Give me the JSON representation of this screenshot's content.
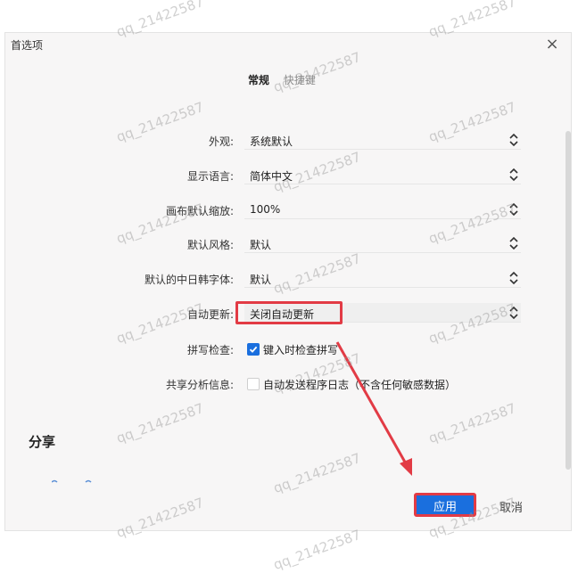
{
  "dialog": {
    "title": "首选项",
    "close_glyph": "×",
    "tabs": [
      {
        "label": "常规"
      },
      {
        "label": "快捷键"
      }
    ],
    "settings": [
      {
        "label": "外观:",
        "value": "系统默认"
      },
      {
        "label": "显示语言:",
        "value": "简体中文"
      },
      {
        "label": "画布默认缩放:",
        "value": "100%"
      },
      {
        "label": "默认风格:",
        "value": "默认"
      },
      {
        "label": "默认的中日韩字体:",
        "value": "默认"
      },
      {
        "label": "自动更新:",
        "value": "关闭自动更新"
      }
    ],
    "spellcheck": {
      "label": "拼写检查:",
      "option": "键入时检查拼写",
      "checked": true
    },
    "analytics": {
      "label": "共享分析信息:",
      "option": "自动发送程序日志（不含任何敏感数据）",
      "checked": false
    },
    "section_share": "分享",
    "apply_label": "应用",
    "cancel_label": "取消"
  },
  "watermark": "qq_21422587",
  "colors": {
    "accent": "#1a6fde",
    "highlight": "#e23b45",
    "dialog_bg": "#f7f6f6"
  }
}
